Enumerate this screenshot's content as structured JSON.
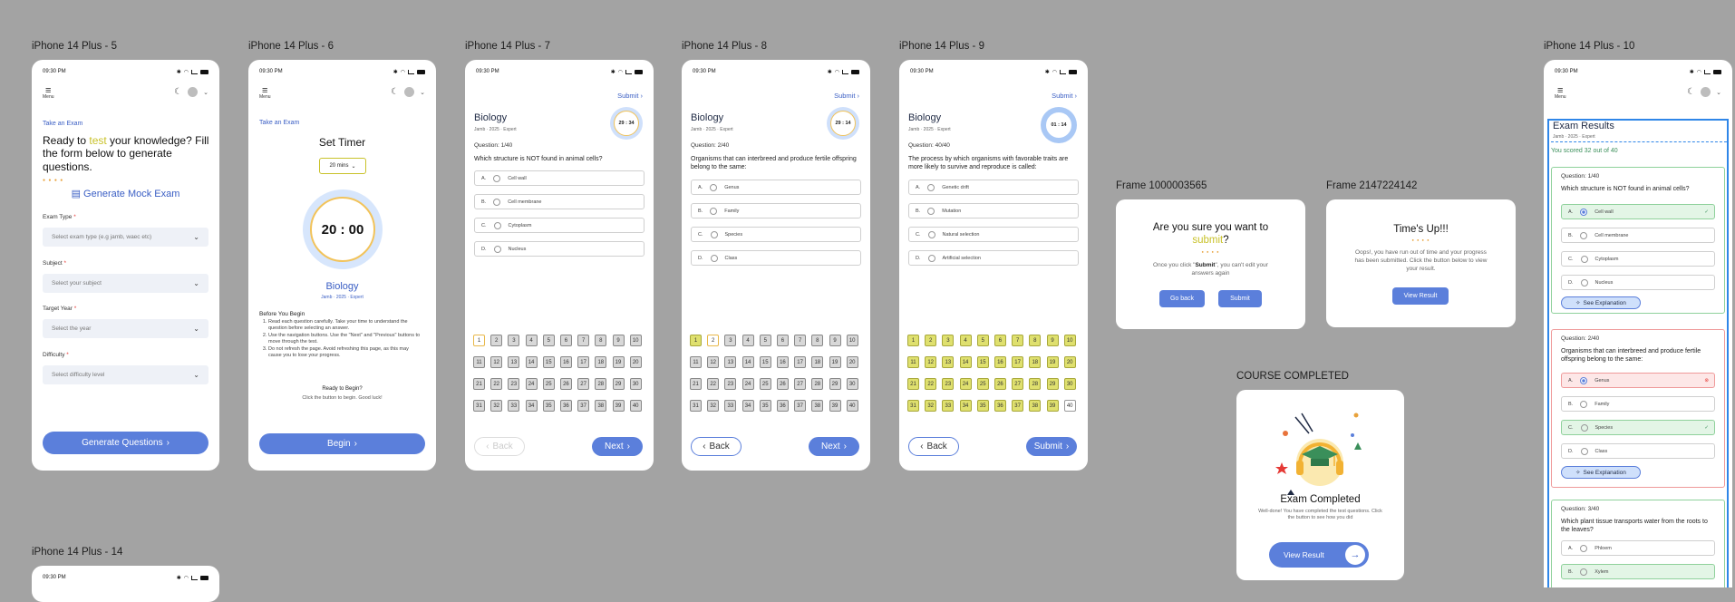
{
  "frames": {
    "f5": "iPhone 14 Plus - 5",
    "f6": "iPhone 14 Plus - 6",
    "f7": "iPhone 14 Plus - 7",
    "f8": "iPhone 14 Plus - 8",
    "f9": "iPhone 14 Plus - 9",
    "f10": "iPhone 14 Plus - 10",
    "f14": "iPhone 14 Plus - 14",
    "fa": "Frame 1000003565",
    "fb": "Frame 2147224142",
    "fc": "COURSE COMPLETED"
  },
  "status": {
    "time": "09:30 PM"
  },
  "menu_label": "Menu",
  "p5": {
    "breadcrumb": "Take an Exam",
    "headline_pre": "Ready to ",
    "headline_hl": "test",
    "headline_post": " your knowledge? Fill the form below to generate questions.",
    "generate_mock": "Generate Mock Exam",
    "fields": [
      {
        "label": "Exam Type",
        "placeholder": "Select exam type (e.g jamb, waec etc)"
      },
      {
        "label": "Subject",
        "placeholder": "Select your subject"
      },
      {
        "label": "Target Year",
        "placeholder": "Select the year"
      },
      {
        "label": "Difficulty",
        "placeholder": "Select difficulty level"
      }
    ],
    "req": "*",
    "button": "Generate Questions"
  },
  "p6": {
    "breadcrumb": "Take an Exam",
    "title": "Set Timer",
    "timer_select": "20 mins",
    "timer": "20 : 00",
    "subject": "Biology",
    "meta": "Jamb · 2025 · Expert",
    "before_title": "Before You Begin",
    "rules": [
      "Read each question carefully. Take your time to understand the question before selecting an answer.",
      "Use the navigation buttons. Use the \"Next\" and \"Previous\" buttons to move through the test.",
      "Do not refresh the page. Avoid refreshing this page, as this may cause you to lose your progress."
    ],
    "ready": "Ready to Begin?",
    "ready_sub": "Click the button to begin. Good luck!",
    "button": "Begin"
  },
  "q7": {
    "submit": "Submit",
    "subject": "Biology",
    "meta": "Jamb · 2025 · Expert",
    "timer": "29 : 34",
    "qnum": "Question: 1/40",
    "question": "Which structure is NOT found in animal cells?",
    "options": [
      {
        "k": "A.",
        "t": "Cell wall"
      },
      {
        "k": "B.",
        "t": "Cell membrane"
      },
      {
        "k": "C.",
        "t": "Cytoplasm"
      },
      {
        "k": "D.",
        "t": "Nucleus"
      }
    ],
    "back": "Back",
    "next": "Next"
  },
  "q8": {
    "submit": "Submit",
    "subject": "Biology",
    "meta": "Jamb · 2025 · Expert",
    "timer": "29 : 14",
    "qnum": "Question: 2/40",
    "question": "Organisms that can interbreed and produce fertile offspring belong to the same:",
    "options": [
      {
        "k": "A.",
        "t": "Genus"
      },
      {
        "k": "B.",
        "t": "Family"
      },
      {
        "k": "C.",
        "t": "Species"
      },
      {
        "k": "D.",
        "t": "Class"
      }
    ],
    "back": "Back",
    "next": "Next"
  },
  "q9": {
    "submit": "Submit",
    "subject": "Biology",
    "meta": "Jamb · 2025 · Expert",
    "timer": "01 : 14",
    "qnum": "Question: 40/40",
    "question": "The process by which organisms with favorable traits are more likely to survive and reproduce is called:",
    "options": [
      {
        "k": "A.",
        "t": "Genetic drift"
      },
      {
        "k": "B.",
        "t": "Mutation"
      },
      {
        "k": "C.",
        "t": "Natural selection"
      },
      {
        "k": "D.",
        "t": "Artificial selection"
      }
    ],
    "back": "Back",
    "next": "Submit"
  },
  "grid_numbers": [
    "1",
    "2",
    "3",
    "4",
    "5",
    "6",
    "7",
    "8",
    "9",
    "10",
    "11",
    "12",
    "13",
    "14",
    "15",
    "16",
    "17",
    "18",
    "19",
    "20",
    "21",
    "22",
    "23",
    "24",
    "25",
    "26",
    "27",
    "28",
    "29",
    "30",
    "31",
    "32",
    "33",
    "34",
    "35",
    "36",
    "37",
    "38",
    "39",
    "40"
  ],
  "confirm": {
    "title_pre": "Are you sure you want to ",
    "title_hl": "submit",
    "title_post": "?",
    "body_pre": "Once you click \"",
    "body_bold": "Submit",
    "body_post": "\", you can't edit your answers again",
    "back": "Go back",
    "submit": "Submit"
  },
  "timeup": {
    "title": "Time's Up!!!",
    "body": "Oops!, you have run out of time and your progress has been submitted. Click the button below to view your result.",
    "button": "View Result"
  },
  "completed": {
    "title": "Exam Completed",
    "body": "Well-done! You have completed the test questions. Click the button to see how you did",
    "button": "View Result"
  },
  "results": {
    "title": "Exam Results",
    "meta": "Jamb · 2025 · Expert",
    "score": "You scored 32 out of 40",
    "explain": "See Explanation",
    "q1": {
      "qnum": "Question: 1/40",
      "question": "Which structure is NOT found in animal cells?",
      "options": [
        {
          "k": "A.",
          "t": "Cell wall"
        },
        {
          "k": "B.",
          "t": "Cell membrane"
        },
        {
          "k": "C.",
          "t": "Cytoplasm"
        },
        {
          "k": "D.",
          "t": "Nucleus"
        }
      ]
    },
    "q2": {
      "qnum": "Question: 2/40",
      "question": "Organisms that can interbreed and produce fertile offspring belong to the same:",
      "options": [
        {
          "k": "A.",
          "t": "Genus"
        },
        {
          "k": "B.",
          "t": "Family"
        },
        {
          "k": "C.",
          "t": "Species"
        },
        {
          "k": "D.",
          "t": "Class"
        }
      ]
    },
    "q3": {
      "qnum": "Question: 3/40",
      "question": "Which plant tissue transports water from the roots to the leaves?",
      "options": [
        {
          "k": "A.",
          "t": "Phloem"
        },
        {
          "k": "B.",
          "t": "Xylem"
        }
      ]
    }
  },
  "colors": {
    "accent": "#5b7fdb",
    "highlight": "#c9c22a",
    "correct": "#e3f5e6",
    "wrong": "#fde7e7",
    "answered": "#dfe06e"
  }
}
